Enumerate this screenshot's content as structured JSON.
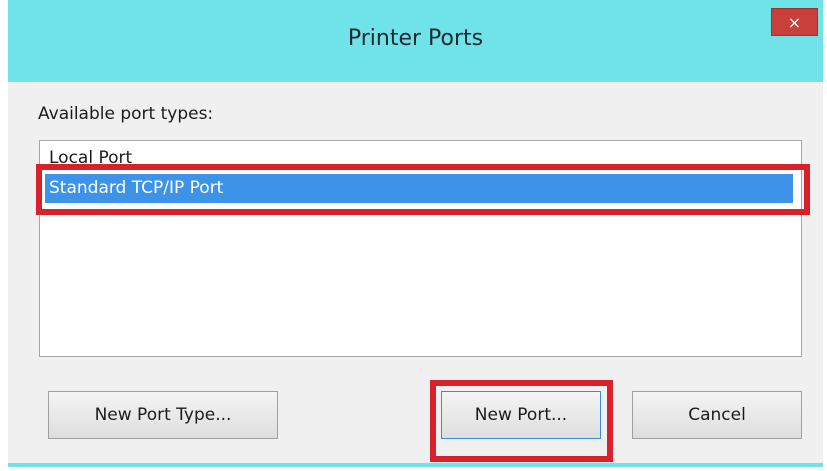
{
  "window": {
    "title": "Printer Ports",
    "close_label": "×"
  },
  "dialog": {
    "list_label": "Available port types:",
    "port_types": [
      {
        "label": "Local Port",
        "selected": false
      },
      {
        "label": "Standard TCP/IP Port",
        "selected": true
      }
    ]
  },
  "buttons": {
    "new_port_type": "New Port Type...",
    "new_port": "New Port...",
    "cancel": "Cancel"
  },
  "colors": {
    "titlebar": "#6fe3e8",
    "close_button": "#c9403a",
    "selection": "#3c93e8",
    "annotation": "#d8222b"
  }
}
